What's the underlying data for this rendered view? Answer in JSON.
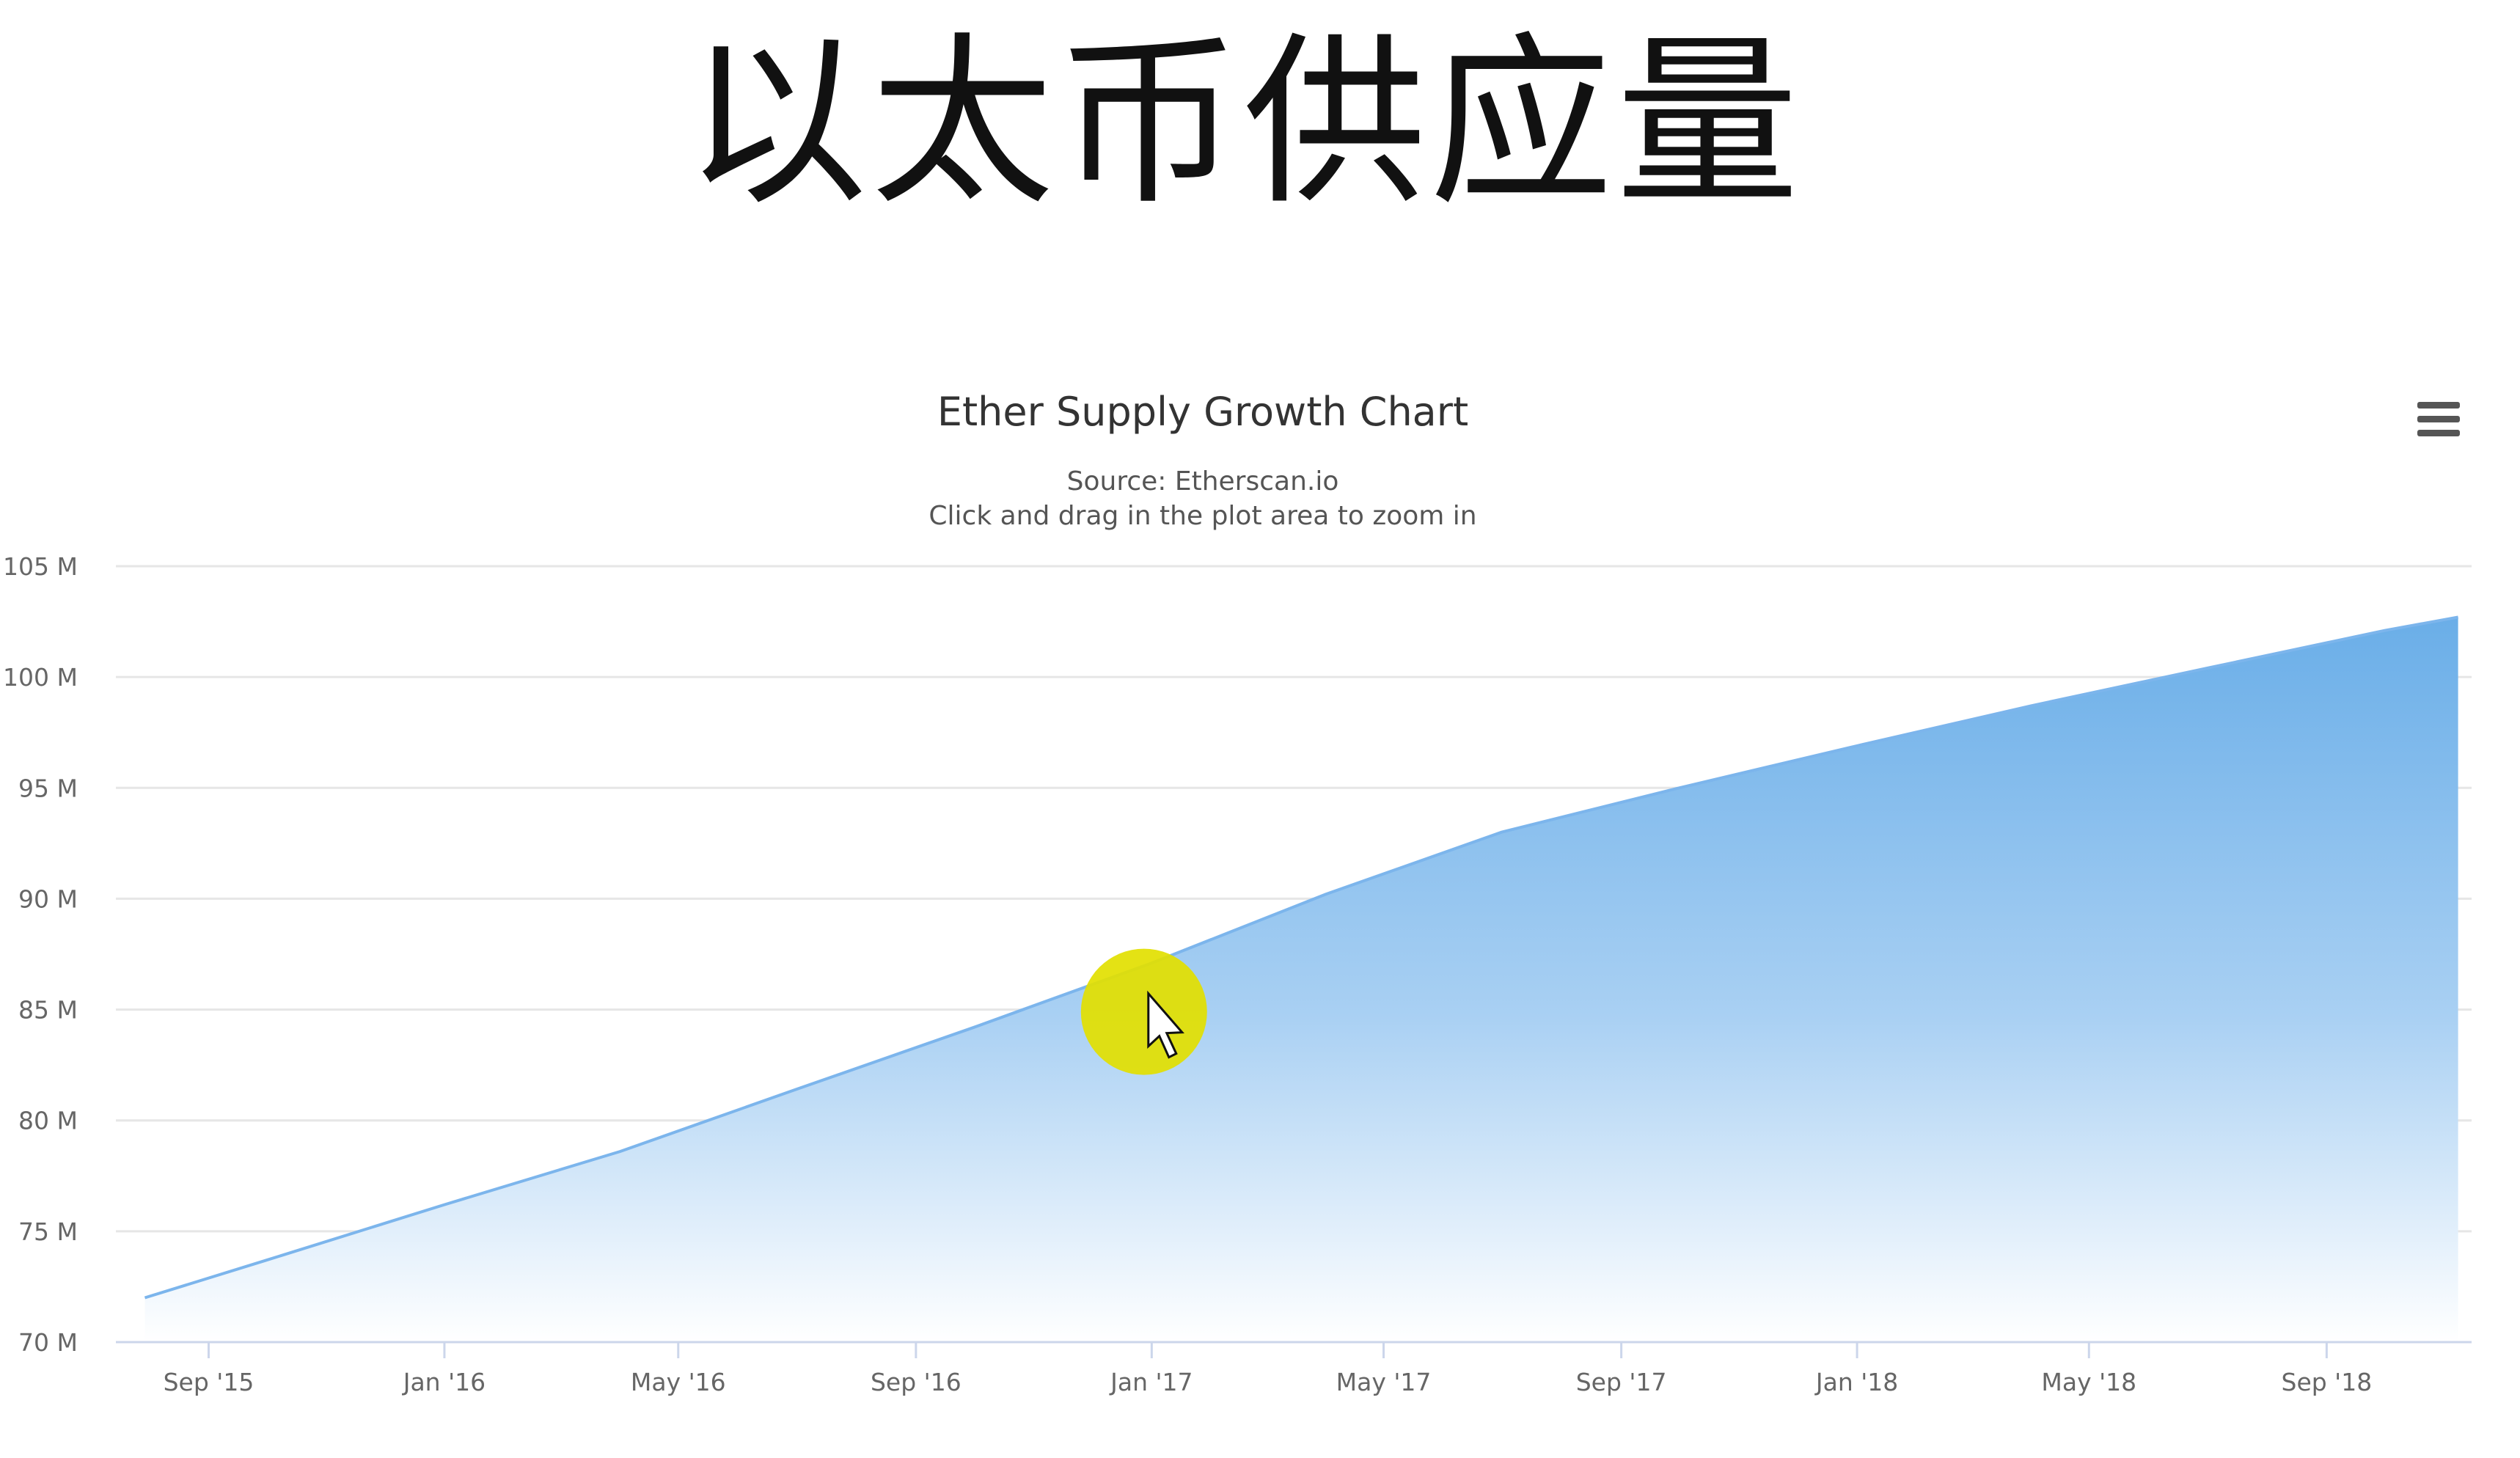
{
  "page": {
    "heading": "以太币供应量"
  },
  "chart_data": {
    "type": "area",
    "title": "Ether Supply Growth Chart",
    "subtitle_lines": [
      "Source: Etherscan.io",
      "Click and drag in the plot area to zoom in"
    ],
    "xlabel": "",
    "ylabel": "",
    "ylim": [
      70000000,
      105000000
    ],
    "y_ticks": [
      {
        "value": 70000000,
        "label": "70 M"
      },
      {
        "value": 75000000,
        "label": "75 M"
      },
      {
        "value": 80000000,
        "label": "80 M"
      },
      {
        "value": 85000000,
        "label": "85 M"
      },
      {
        "value": 90000000,
        "label": "90 M"
      },
      {
        "value": 95000000,
        "label": "95 M"
      },
      {
        "value": 100000000,
        "label": "100 M"
      },
      {
        "value": 105000000,
        "label": "105 M"
      }
    ],
    "x_ticks": [
      {
        "date": "2015-09-01",
        "label": "Sep '15"
      },
      {
        "date": "2016-01-01",
        "label": "Jan '16"
      },
      {
        "date": "2016-05-01",
        "label": "May '16"
      },
      {
        "date": "2016-09-01",
        "label": "Sep '16"
      },
      {
        "date": "2017-01-01",
        "label": "Jan '17"
      },
      {
        "date": "2017-05-01",
        "label": "May '17"
      },
      {
        "date": "2017-09-01",
        "label": "Sep '17"
      },
      {
        "date": "2018-01-01",
        "label": "Jan '18"
      },
      {
        "date": "2018-05-01",
        "label": "May '18"
      },
      {
        "date": "2018-09-01",
        "label": "Sep '18"
      }
    ],
    "x_range": [
      "2015-07-15",
      "2018-11-15"
    ],
    "grid": true,
    "legend": "none",
    "colors": {
      "line": "#7cb5ec",
      "fill_top": "#6aaee8",
      "fill_bottom": "#ffffff",
      "grid": "#e6e6e6",
      "axis_text": "#666666",
      "title": "#333333"
    },
    "series": [
      {
        "x": [
          "2015-07-30",
          "2015-10-01",
          "2016-01-01",
          "2016-04-01",
          "2016-07-01",
          "2016-10-01",
          "2017-01-01",
          "2017-04-01",
          "2017-07-01",
          "2017-10-01",
          "2018-01-01",
          "2018-04-01",
          "2018-07-01",
          "2018-10-01",
          "2018-11-08"
        ],
        "values": [
          72000000,
          73700000,
          76200000,
          78600000,
          81400000,
          84200000,
          87100000,
          90200000,
          93000000,
          95000000,
          96900000,
          98700000,
          100400000,
          102100000,
          102700000
        ]
      }
    ]
  },
  "overlay": {
    "cursor_highlight_color": "#e2e000"
  },
  "icons": {
    "menu": "hamburger-menu-icon"
  }
}
